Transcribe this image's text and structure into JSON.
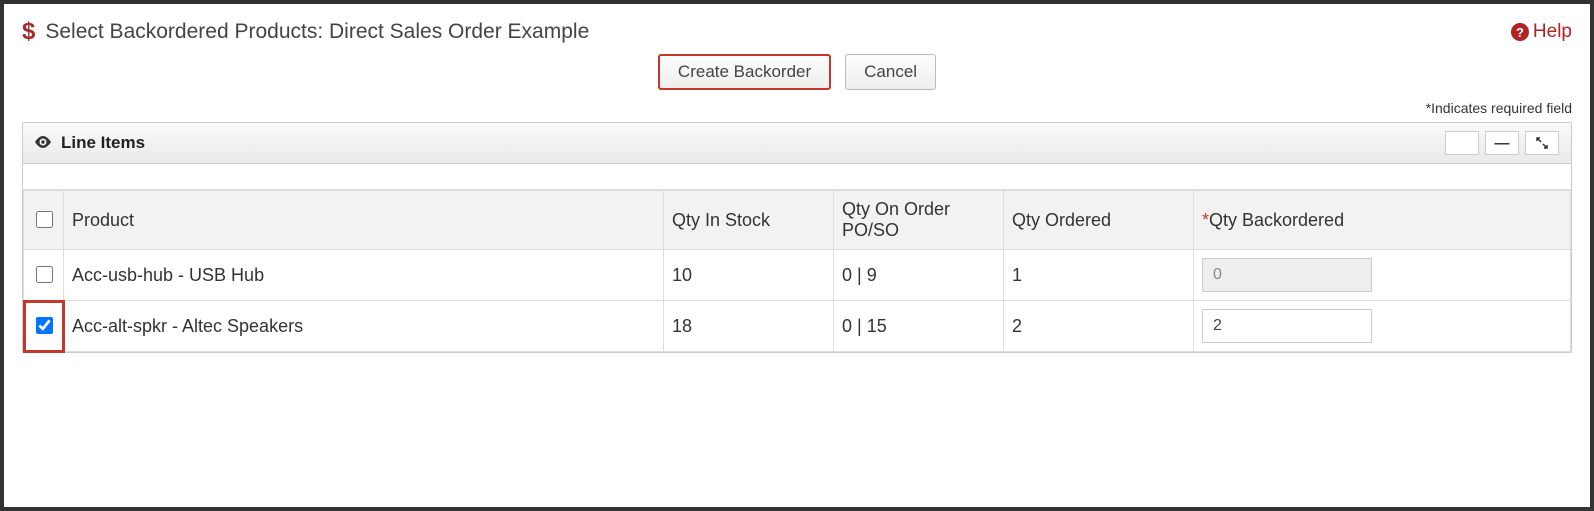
{
  "header": {
    "title": "Select Backordered Products:  Direct Sales Order Example",
    "help_label": "Help"
  },
  "actions": {
    "create_label": "Create Backorder",
    "cancel_label": "Cancel"
  },
  "required_note": "*Indicates required field",
  "panel": {
    "title": "Line Items"
  },
  "columns": {
    "product": "Product",
    "qty_in_stock": "Qty In Stock",
    "qty_on_order": "Qty On Order PO/SO",
    "qty_ordered": "Qty Ordered",
    "qty_backordered": "Qty Backordered"
  },
  "rows": [
    {
      "checked": false,
      "product": "Acc-usb-hub - USB Hub",
      "qty_in_stock": "10",
      "qty_on_order": "0 | 9",
      "qty_ordered": "1",
      "qty_backordered": "0",
      "editable": false,
      "highlight": false
    },
    {
      "checked": true,
      "product": "Acc-alt-spkr - Altec Speakers",
      "qty_in_stock": "18",
      "qty_on_order": "0 | 15",
      "qty_ordered": "2",
      "qty_backordered": "2",
      "editable": true,
      "highlight": true
    }
  ]
}
